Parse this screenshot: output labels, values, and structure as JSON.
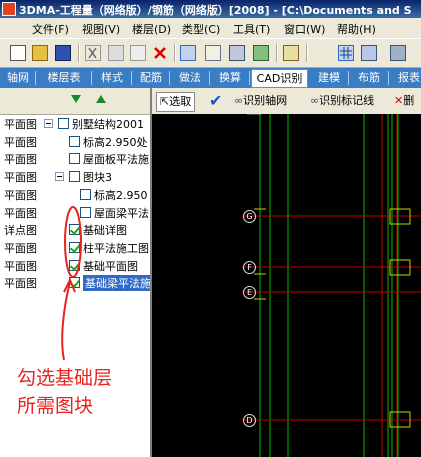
{
  "window": {
    "title": "3DMA-工程量（网络版）/钢筋（网络版）[2008] - [C:\\Documents and S"
  },
  "menu": [
    "文件(F)",
    "视图(V)",
    "楼层(D)",
    "类型(C)",
    "工具(T)",
    "窗口(W)",
    "帮助(H)"
  ],
  "toolbar": {
    "icons": [
      "new-file-icon",
      "open-folder-icon",
      "save-icon",
      "cut-icon",
      "copy-icon",
      "paste-icon",
      "delete-icon",
      "tree-view-icon",
      "table-view-icon",
      "properties-icon",
      "image-icon",
      "help-icon",
      "grid-icon",
      "layers-icon",
      "3d-view-icon"
    ]
  },
  "tabs": [
    {
      "label": "轴网",
      "active": false
    },
    {
      "label": "楼层表",
      "active": false
    },
    {
      "label": "样式",
      "active": false
    },
    {
      "label": "配筋",
      "active": false
    },
    {
      "label": "做法",
      "active": false
    },
    {
      "label": "换算",
      "active": false
    },
    {
      "label": "CAD识别",
      "active": true
    },
    {
      "label": "建模",
      "active": false
    },
    {
      "label": "布筋",
      "active": false
    },
    {
      "label": "报表",
      "active": false
    }
  ],
  "tree": [
    {
      "kind": "平面图",
      "label": "别墅结构2001",
      "level": 0,
      "expand": true,
      "checked": false,
      "selected": false
    },
    {
      "kind": "平面图",
      "label": "标高2.950处",
      "level": 1,
      "expand": false,
      "checked": false,
      "selected": false
    },
    {
      "kind": "平面图",
      "label": "屋面板平法施",
      "level": 1,
      "expand": false,
      "checked": false,
      "selected": false
    },
    {
      "kind": "平面图",
      "label": "图块3",
      "level": 1,
      "expand": true,
      "checked": false,
      "selected": false
    },
    {
      "kind": "平面图",
      "label": "标高2.950",
      "level": 2,
      "expand": false,
      "checked": false,
      "selected": false
    },
    {
      "kind": "平面图",
      "label": "屋面梁平法",
      "level": 2,
      "expand": false,
      "checked": false,
      "selected": false
    },
    {
      "kind": "详点图",
      "label": "基础详图",
      "level": 1,
      "expand": false,
      "checked": true,
      "selected": false
    },
    {
      "kind": "平面图",
      "label": "柱平法施工图",
      "level": 1,
      "expand": false,
      "checked": true,
      "selected": false
    },
    {
      "kind": "平面图",
      "label": "基础平面图",
      "level": 1,
      "expand": false,
      "checked": true,
      "selected": false
    },
    {
      "kind": "平面图",
      "label": "基础梁平法施",
      "level": 1,
      "expand": false,
      "checked": true,
      "selected": true
    }
  ],
  "cad_toolbar": {
    "select_label": "选取",
    "identify_axis_label": "识别轴网",
    "identify_marks_label": "识别标记线",
    "delete_label": "删"
  },
  "axis_labels": [
    "G",
    "F",
    "E",
    "D"
  ],
  "annotation": {
    "line1": "勾选基础层",
    "line2": "所需图块"
  },
  "colors": {
    "tab_bg": "#3a7dc4",
    "cad_bg": "#000000",
    "annotation": "#e8231c",
    "selection": "#316ac5"
  }
}
